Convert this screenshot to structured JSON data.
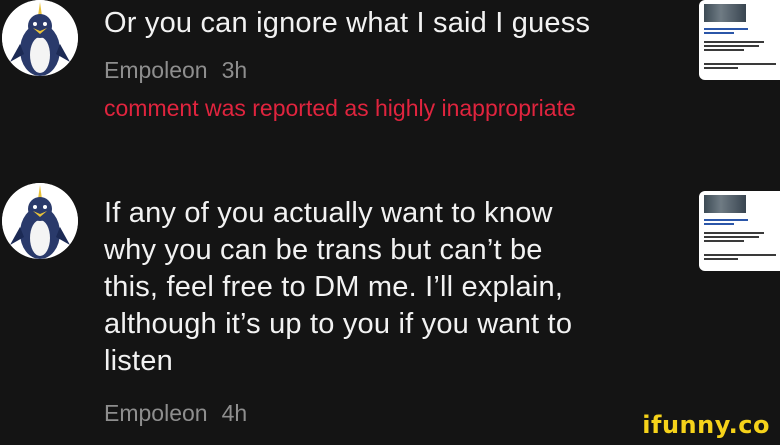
{
  "comments": [
    {
      "text": "Or you can ignore what I said I guess",
      "author": "Empoleon",
      "time": "3h",
      "report_notice": "comment was reported as highly inappropriate",
      "avatar_icon": "empoleon-avatar-icon"
    },
    {
      "text_lines": [
        "If any of you actually want to know",
        "why you can be trans but can’t be",
        "this, feel free to DM me. I’ll explain,",
        "although it’s up to you if you want to",
        "listen"
      ],
      "author": "Empoleon",
      "time": "4h",
      "avatar_icon": "empoleon-avatar-icon"
    }
  ],
  "watermark": "ifunny.co",
  "colors": {
    "background": "#141414",
    "text": "#f2f2f2",
    "meta": "#8e8e8e",
    "report": "#e0243e",
    "watermark": "#f5d21a"
  }
}
